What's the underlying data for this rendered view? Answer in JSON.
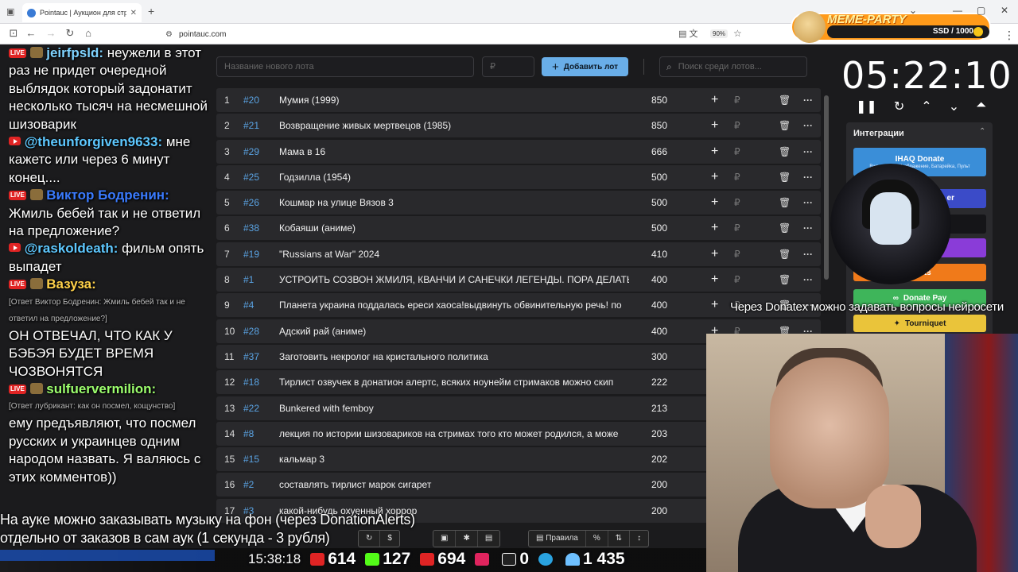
{
  "browser": {
    "tab_title": "Pointauc | Аукцион для стримеров",
    "url": "pointauc.com",
    "zoom": "90%"
  },
  "meme_party": {
    "title": "MEME-PARTY",
    "balance": "SSD / 1000"
  },
  "app": {
    "new_lot_placeholder": "Название нового лота",
    "amount_placeholder": "₽",
    "add_button": "Добавить лот",
    "search_placeholder": "Поиск среди лотов...",
    "timer": "05:22:10",
    "integrations_label": "Интеграции",
    "integrations": {
      "ihaq": "IHAQ Donate",
      "ihaq_sub": "Видео, Звук, Изображение, Батарейка, Пульт",
      "second": "er",
      "alerts": "Alerts",
      "donatepay": "Donate Pay",
      "tourniquet": "Tourniquet"
    },
    "toolbar": {
      "rules": "Правила"
    },
    "rows": [
      {
        "n": "1",
        "id": "#20",
        "name": "Мумия (1999)",
        "amount": "850"
      },
      {
        "n": "2",
        "id": "#21",
        "name": "Возвращение живых мертвецов (1985)",
        "amount": "850"
      },
      {
        "n": "3",
        "id": "#29",
        "name": "Мама в 16",
        "amount": "666"
      },
      {
        "n": "4",
        "id": "#25",
        "name": "Годзилла (1954)",
        "amount": "500"
      },
      {
        "n": "5",
        "id": "#26",
        "name": "Кошмар на улице Вязов 3",
        "amount": "500"
      },
      {
        "n": "6",
        "id": "#38",
        "name": "Кобаяши (аниме)",
        "amount": "500"
      },
      {
        "n": "7",
        "id": "#19",
        "name": "\"Russians at War\" 2024",
        "amount": "410"
      },
      {
        "n": "8",
        "id": "#1",
        "name": "УСТРОИТЬ СОЗВОН ЖМИЛЯ, КВАНЧИ И САНЕЧКИ ЛЕГЕНДЫ. ПОРА ДЕЛАТЬ",
        "amount": "400"
      },
      {
        "n": "9",
        "id": "#4",
        "name": "Планета украина поддалась ереси хаоса!выдвинуть обвинительную речь! по",
        "amount": "400"
      },
      {
        "n": "10",
        "id": "#28",
        "name": "Адский рай (аниме)",
        "amount": "400"
      },
      {
        "n": "11",
        "id": "#37",
        "name": "Заготовить некролог на кристального политика",
        "amount": "300"
      },
      {
        "n": "12",
        "id": "#18",
        "name": "Тирлист озвучек в донатион алертс, всяких ноунейм стримаков можно скип",
        "amount": "222"
      },
      {
        "n": "13",
        "id": "#22",
        "name": "Bunkered with femboy",
        "amount": "213"
      },
      {
        "n": "14",
        "id": "#8",
        "name": "лекция по истории шизовариков на стримах того кто может родился, а може",
        "amount": "203"
      },
      {
        "n": "15",
        "id": "#15",
        "name": "кальмар 3",
        "amount": "202"
      },
      {
        "n": "16",
        "id": "#2",
        "name": "составлять тирлист марок сигарет",
        "amount": "200"
      },
      {
        "n": "17",
        "id": "#3",
        "name": "какой-нибудь охуенный хоррор",
        "amount": "200"
      }
    ]
  },
  "chat": [
    {
      "user": "jeirfpsld:",
      "color": "#7fd3ff",
      "text": "неужели в этот раз не придет очередной выблядок который задонатит несколько тысяч на несмешной шизоварик"
    },
    {
      "user": "@theunforgiven9633:",
      "color": "#5ec8ff",
      "text": "мне кажетс или через 6 минут конец...."
    },
    {
      "user": "Виктор Бодренин:",
      "color": "#3a7bff",
      "text": "Жмиль бебей так и не ответил на предложение?"
    },
    {
      "user": "@raskoldeath:",
      "color": "#5ec8ff",
      "text": "фильм опять выпадет"
    },
    {
      "user": "Вазуза:",
      "color": "#ffd24a",
      "reply": "[Ответ Виктор Бодренин: Жмиль бебей так и не ответил на предложение?]",
      "text": "ОН ОТВЕЧАЛ, ЧТО КАК У БЭБЭЯ БУДЕТ ВРЕМЯ ЧОЗВОНЯТСЯ"
    },
    {
      "user": "sulfuervermilion:",
      "color": "#9dff6e",
      "reply": "[Ответ лубрикант: как он посмел, кощунство]",
      "text": "ему предъявляют, что посмел русских и украинцев одним народом назвать. Я валяюсь с этих комментов))"
    }
  ],
  "captions": {
    "line1": "На ауке можно заказывать музыку на фон (через DonationAlerts)",
    "line2": "отдельно от заказов в сам аук (1 секунда - 3 рубля)",
    "right": "Через Donatex можно задавать вопросы нейросети"
  },
  "stats": {
    "clock": "15:38:18",
    "youtube": "614",
    "kick": "127",
    "live": "694",
    "rutube": "0",
    "total": "1 435"
  }
}
